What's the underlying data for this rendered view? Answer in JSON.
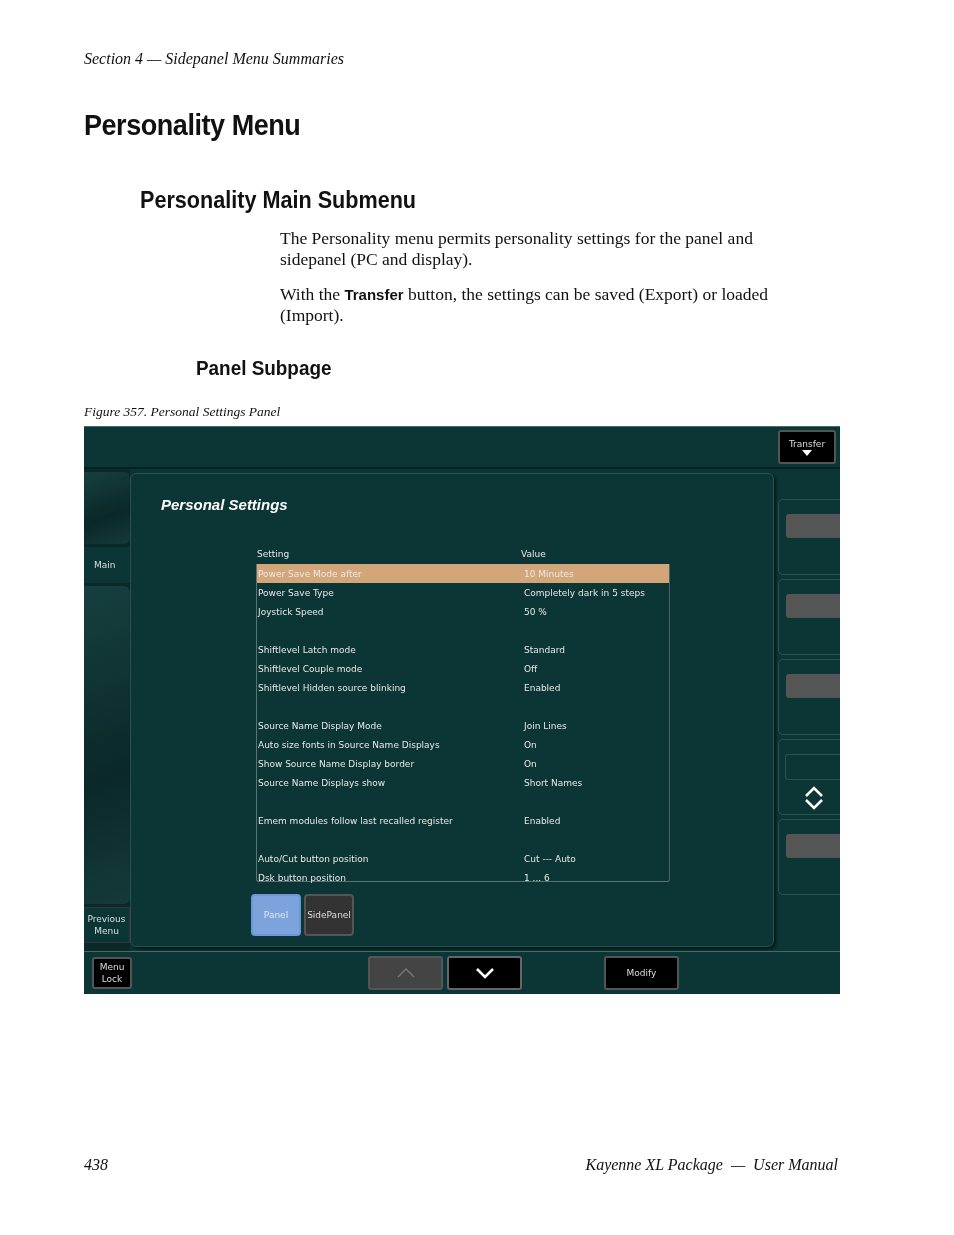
{
  "page_header": "Section 4 — Sidepanel Menu Summaries",
  "title": "Personality Menu",
  "section_title": "Personality Main Submenu",
  "paragraphs": [
    "The Personality menu permits personality settings for the panel and sidepanel (PC and display).",
    "With the **Transfer** button, the settings can be saved (Export) or loaded (Import)."
  ],
  "subsection_title": "Panel Subpage",
  "figure_caption": "Figure 357.  Personal Settings Panel",
  "screen": {
    "transfer_button": "Transfer",
    "left_tabs": [
      {
        "label": "Main",
        "selected": true
      }
    ],
    "previous_button": "Previous Menu",
    "panel_title": "Personal Settings",
    "columns": [
      "Setting",
      "Value"
    ],
    "groups": [
      [
        {
          "setting": "Power Save Mode after",
          "value": "10 Minutes",
          "selected": true
        },
        {
          "setting": "Power Save Type",
          "value": "Completely dark in 5 steps",
          "selected": false
        },
        {
          "setting": "Joystick Speed",
          "value": "50  %",
          "selected": false
        }
      ],
      [
        {
          "setting": "Shiftlevel Latch mode",
          "value": "Standard",
          "selected": false
        },
        {
          "setting": "Shiftlevel Couple mode",
          "value": "Off",
          "selected": false
        },
        {
          "setting": "Shiftlevel Hidden source blinking",
          "value": "Enabled",
          "selected": false
        }
      ],
      [
        {
          "setting": "Source Name Display Mode",
          "value": "Join Lines",
          "selected": false
        },
        {
          "setting": "Auto size fonts in Source Name Displays",
          "value": "On",
          "selected": false
        },
        {
          "setting": "Show Source Name Display border",
          "value": "On",
          "selected": false
        },
        {
          "setting": "Source Name Displays show",
          "value": "Short Names",
          "selected": false
        }
      ],
      [
        {
          "setting": "Emem modules follow last recalled register",
          "value": "Enabled",
          "selected": false
        }
      ],
      [
        {
          "setting": "Auto/Cut button position",
          "value": "Cut --- Auto",
          "selected": false
        },
        {
          "setting": "Dsk button position",
          "value": "1 ... 6",
          "selected": false
        }
      ]
    ],
    "subpage_tabs": [
      {
        "label": "Panel",
        "selected": true
      },
      {
        "label": "SidePanel",
        "selected": false
      }
    ],
    "side_buttons": [
      {
        "kind": "blank"
      },
      {
        "kind": "blank"
      },
      {
        "kind": "blank"
      },
      {
        "kind": "scroll"
      },
      {
        "kind": "blank"
      }
    ],
    "menu_lock_button": "Menu Lock",
    "scroll_buttons": [
      {
        "kind": "up",
        "disabled": true
      },
      {
        "kind": "down",
        "disabled": false
      }
    ],
    "modify_button": "Modify"
  },
  "footer": {
    "page_number": "438",
    "document_title": "Kayenne XL Package  —  User Manual"
  }
}
